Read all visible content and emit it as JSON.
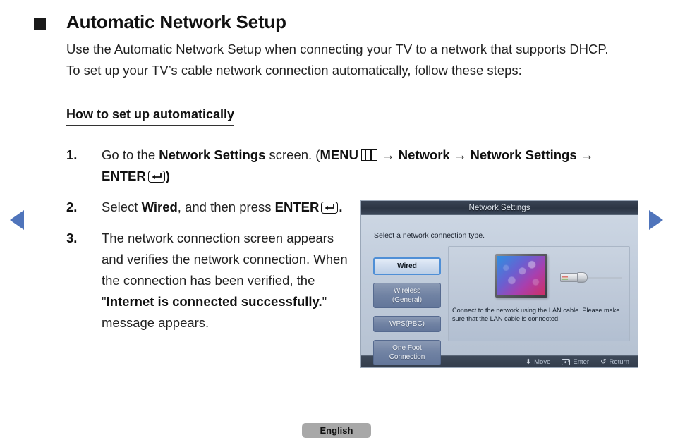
{
  "heading": "Automatic Network Setup",
  "intro": "Use the Automatic Network Setup when connecting your TV to a network that supports DHCP. To set up your TV’s cable network connection automatically, follow these steps:",
  "subheading": "How to set up automatically",
  "steps": [
    {
      "num": "1.",
      "seg_a": "Go to the ",
      "seg_b": "Network Settings",
      "seg_c": " screen. (",
      "menu_label": "MENU",
      "arrow1": "→",
      "network": "Network",
      "arrow2": "→",
      "network_settings": "Network Settings",
      "arrow3": "→",
      "enter_label": "ENTER",
      "closing": ")"
    },
    {
      "num": "2.",
      "seg_a": "Select ",
      "seg_b": "Wired",
      "seg_c": ", and then press ",
      "enter_label": "ENTER",
      "closing": "."
    },
    {
      "num": "3.",
      "seg_a": "The network connection screen appears and verifies the network connection. When the connection has been verified, the \"",
      "seg_b": "Internet is connected successfully.",
      "seg_c": "\" message appears."
    }
  ],
  "tv": {
    "title": "Network Settings",
    "subtitle": "Select a network connection type.",
    "buttons": [
      {
        "label": "Wired",
        "selected": true
      },
      {
        "label": "Wireless\n(General)",
        "line1": "Wireless",
        "line2": "(General)",
        "selected": false
      },
      {
        "label": "WPS(PBC)",
        "line1": "WPS(PBC)",
        "line2": "",
        "selected": false
      },
      {
        "label": "One Foot Connection",
        "line1": "One Foot",
        "line2": "Connection",
        "selected": false
      }
    ],
    "description": "Connect to the network using the LAN cable. Please make sure that the LAN cable is connected.",
    "footer": [
      {
        "icon": "⬍",
        "label": "Move"
      },
      {
        "icon": "enter-box",
        "label": "Enter"
      },
      {
        "icon": "↺",
        "label": "Return"
      }
    ]
  },
  "footer": {
    "language": "English"
  },
  "colors": {
    "accent_blue": "#4f74bb",
    "text": "#222222",
    "tv_header_bg": "#2c3544",
    "tv_body_bg": "#c2cddc",
    "lang_badge_bg": "#a8a8a8"
  }
}
